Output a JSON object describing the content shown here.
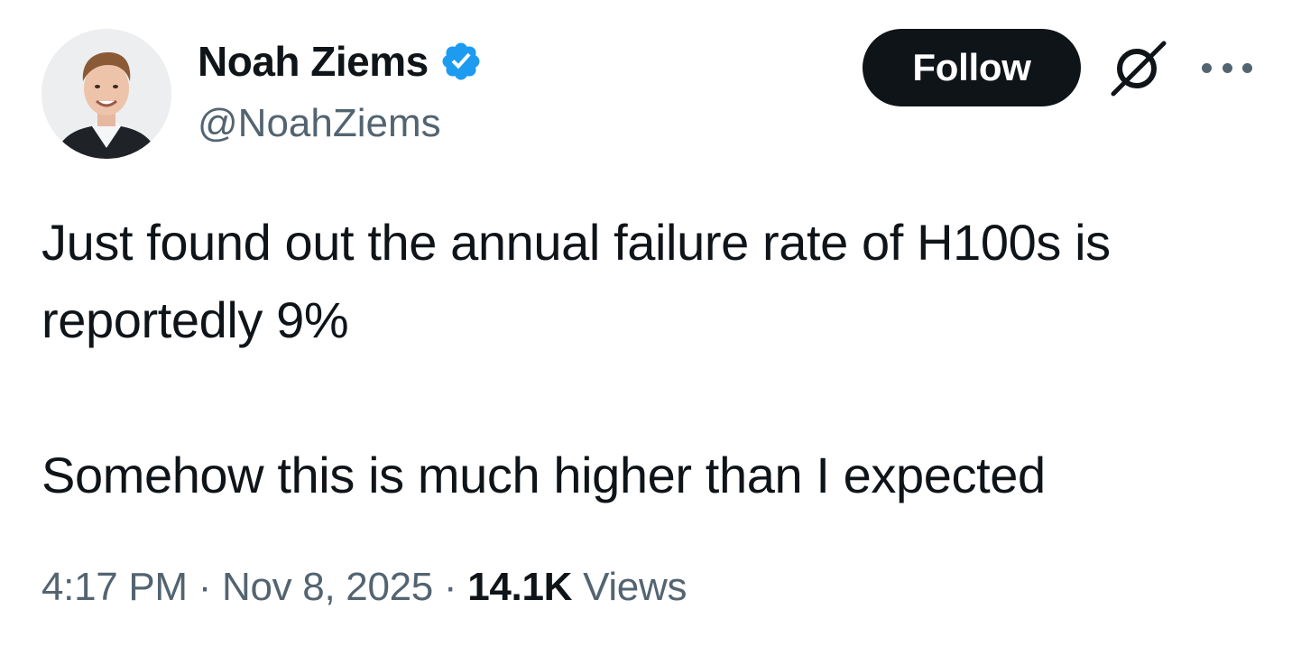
{
  "author": {
    "display_name": "Noah Ziems",
    "handle": "@NoahZiems",
    "verified": true,
    "verified_color": "#1d9bf0"
  },
  "actions": {
    "follow_label": "Follow",
    "follow_bg": "#0f1419",
    "grok_icon": "grok-icon",
    "more_icon": "more-options-icon"
  },
  "tweet": {
    "line1": "Just found out the annual failure rate of H100s is reportedly 9%",
    "line2": "Somehow this is much higher than I expected"
  },
  "meta": {
    "time": "4:17 PM",
    "separator": "·",
    "date": "Nov 8, 2025",
    "views_count": "14.1K",
    "views_label": "Views"
  }
}
